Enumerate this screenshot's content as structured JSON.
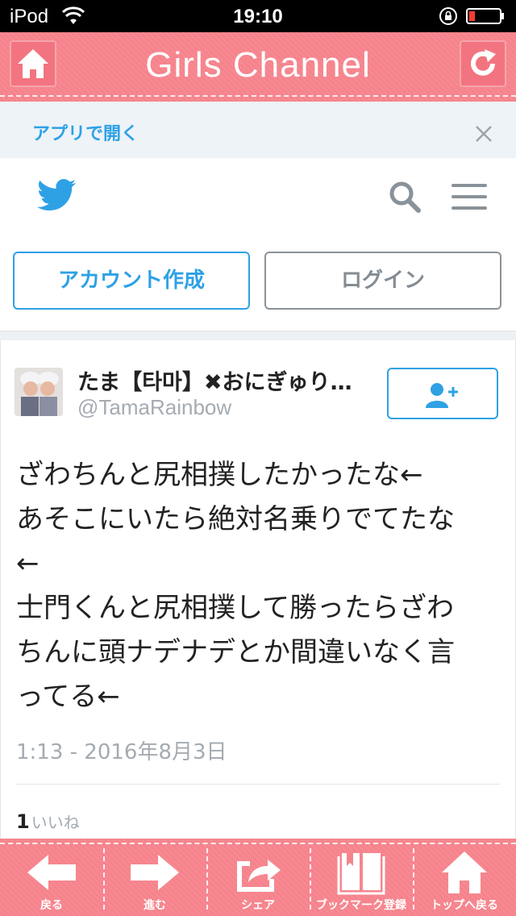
{
  "status_bar": {
    "carrier": "iPod",
    "time": "19:10"
  },
  "header": {
    "title": "Girls Channel"
  },
  "banner": {
    "open_in_app": "アプリで開く"
  },
  "twitter": {
    "signup_label": "アカウント作成",
    "login_label": "ログイン",
    "accent_color": "#2ea1e5"
  },
  "tweet": {
    "display_name": "たま【타마】✖おにぎゅり…",
    "handle": "@TamaRainbow",
    "lines": [
      "ざわちんと尻相撲したかったな←",
      "あそこにいたら絶対名乗りでてたな",
      "←",
      "士門くんと尻相撲して勝ったらざわ",
      "ちんに頭ナデナデとか間違いなく言",
      "ってる←"
    ],
    "timestamp": "1:13 - 2016年8月3日",
    "likes_count": "1",
    "likes_label": "いいね"
  },
  "bottom_bar": {
    "items": [
      {
        "label": "戻る",
        "icon": "arrow-left-icon"
      },
      {
        "label": "進む",
        "icon": "arrow-right-icon"
      },
      {
        "label": "シェア",
        "icon": "share-icon"
      },
      {
        "label": "ブックマーク登録",
        "icon": "bookmark-book-icon"
      },
      {
        "label": "トップへ戻る",
        "icon": "home-icon"
      }
    ]
  }
}
